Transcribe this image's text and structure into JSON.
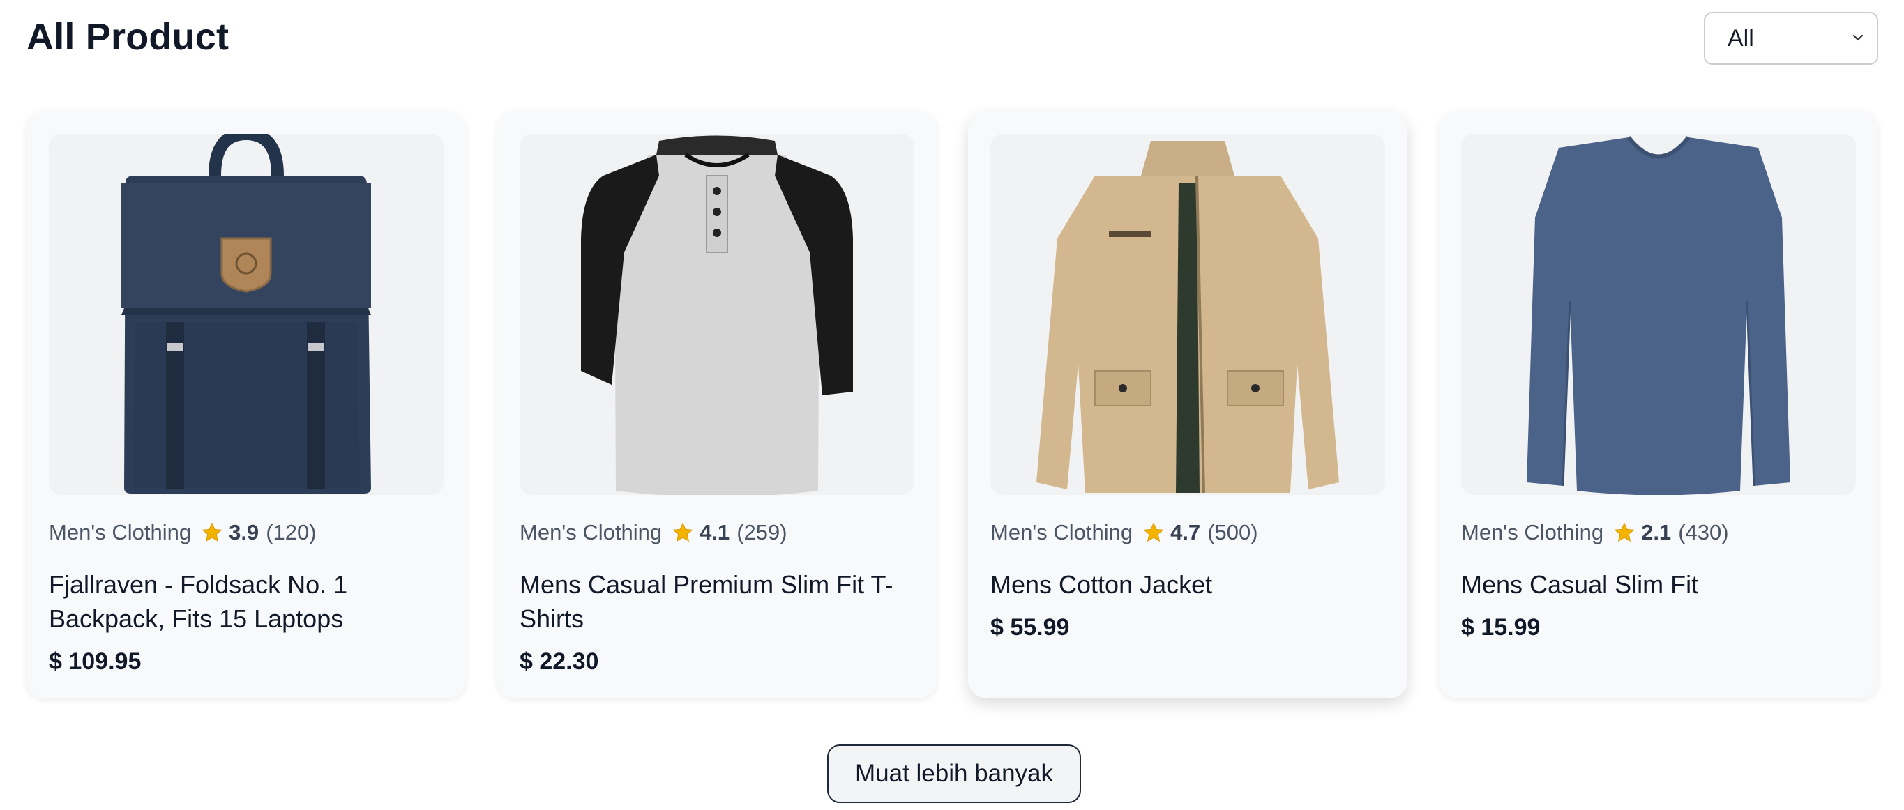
{
  "page": {
    "title": "All Product"
  },
  "filter": {
    "selected": "All"
  },
  "products": [
    {
      "category": "Men's Clothing",
      "rating": "3.9",
      "count": "(120)",
      "title": "Fjallraven - Foldsack No. 1 Backpack, Fits 15 Laptops",
      "price": "$ 109.95",
      "image": "backpack-image"
    },
    {
      "category": "Men's Clothing",
      "rating": "4.1",
      "count": "(259)",
      "title": "Mens Casual Premium Slim Fit T-Shirts",
      "price": "$ 22.30",
      "image": "raglan-tshirt-image"
    },
    {
      "category": "Men's Clothing",
      "rating": "4.7",
      "count": "(500)",
      "title": "Mens Cotton Jacket",
      "price": "$ 55.99",
      "image": "cotton-jacket-image"
    },
    {
      "category": "Men's Clothing",
      "rating": "2.1",
      "count": "(430)",
      "title": "Mens Casual Slim Fit",
      "price": "$ 15.99",
      "image": "long-sleeve-shirt-image"
    }
  ],
  "load_more": {
    "label": "Muat lebih banyak"
  },
  "colors": {
    "star": "#f5b301",
    "card_bg": "#f8f9fb",
    "image_bg": "#f1f2f4"
  }
}
